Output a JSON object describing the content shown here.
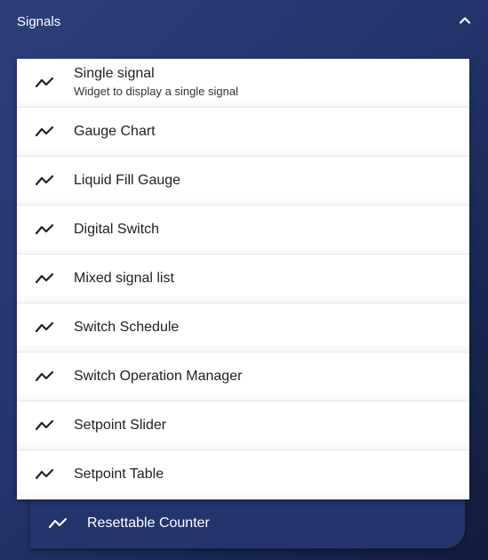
{
  "section": {
    "title": "Signals",
    "toggle_icon": "chevron-up-icon"
  },
  "widgets": {
    "items": [
      {
        "label": "Single signal",
        "description": "Widget to display a single signal",
        "icon": "line-chart-icon"
      },
      {
        "label": "Gauge Chart",
        "icon": "line-chart-icon"
      },
      {
        "label": "Liquid Fill Gauge",
        "icon": "line-chart-icon"
      },
      {
        "label": "Digital Switch",
        "icon": "line-chart-icon"
      },
      {
        "label": "Mixed signal list",
        "icon": "line-chart-icon"
      },
      {
        "label": "Switch Schedule",
        "icon": "line-chart-icon"
      },
      {
        "label": "Switch Operation Manager",
        "icon": "line-chart-icon"
      },
      {
        "label": "Setpoint Slider",
        "icon": "line-chart-icon"
      },
      {
        "label": "Setpoint Table",
        "icon": "line-chart-icon"
      }
    ],
    "dragged_item": {
      "label": "Resettable Counter",
      "icon": "line-chart-icon"
    }
  },
  "colors": {
    "background": "#23356c",
    "background_dark": "#131c3c",
    "list_background": "#ffffff",
    "item_text": "#222222",
    "icon_dark": "#222222",
    "icon_light": "#ffffff"
  }
}
